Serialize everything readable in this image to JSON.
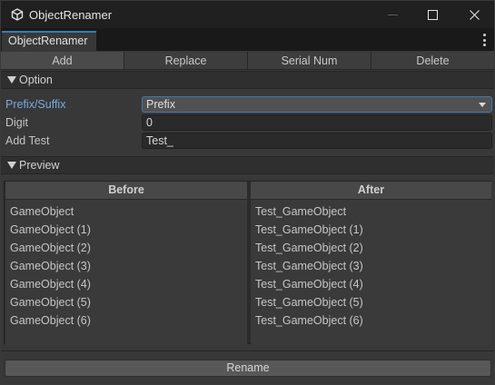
{
  "window": {
    "title": "ObjectRenamer",
    "app_icon": "unity-logo-icon",
    "controls": [
      "minimize-icon",
      "maximize-icon",
      "close-icon"
    ]
  },
  "tab": {
    "label": "ObjectRenamer",
    "menu_icon": "kebab-menu-icon",
    "accent": "#3a79bb"
  },
  "toolbar": {
    "buttons": [
      "Add",
      "Replace",
      "Serial Num",
      "Delete"
    ],
    "active": "Add"
  },
  "option": {
    "header": "Option",
    "prefix_suffix": {
      "label": "Prefix/Suffix",
      "value": "Prefix"
    },
    "digit": {
      "label": "Digit",
      "value": "0"
    },
    "add_text": {
      "label": "Add Test",
      "value": "Test_"
    }
  },
  "preview": {
    "header": "Preview",
    "before_header": "Before",
    "after_header": "After",
    "before": [
      "GameObject",
      "GameObject (1)",
      "GameObject (2)",
      "GameObject (3)",
      "GameObject (4)",
      "GameObject (5)",
      "GameObject (6)"
    ],
    "after": [
      "Test_GameObject",
      "Test_GameObject (1)",
      "Test_GameObject (2)",
      "Test_GameObject (3)",
      "Test_GameObject (4)",
      "Test_GameObject (5)",
      "Test_GameObject (6)"
    ]
  },
  "rename_button": "Rename"
}
